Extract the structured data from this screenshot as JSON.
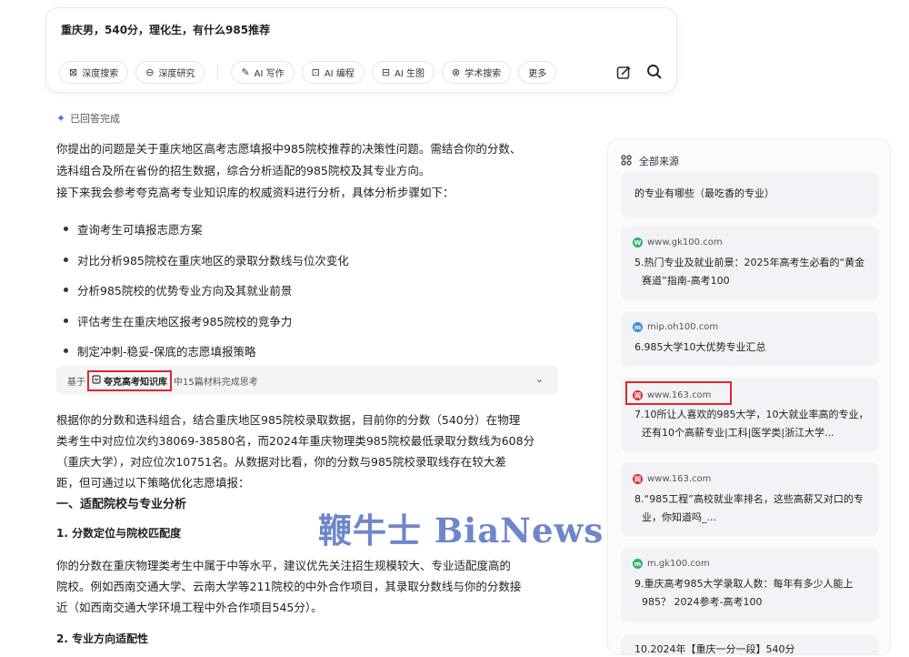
{
  "query": {
    "text": "重庆男，540分，理化生，有什么985推荐",
    "tools": [
      {
        "label": "深度搜索",
        "icon": "deep-search-icon",
        "glyph": "⊠"
      },
      {
        "label": "深度研究",
        "icon": "deep-research-icon",
        "glyph": "⊖"
      },
      {
        "label": "AI 写作",
        "icon": "pen-icon",
        "glyph": "✎"
      },
      {
        "label": "AI 编程",
        "icon": "code-icon",
        "glyph": "⊡"
      },
      {
        "label": "AI 生图",
        "icon": "image-icon",
        "glyph": "⊟"
      },
      {
        "label": "学术搜索",
        "icon": "academic-icon",
        "glyph": "⊗"
      },
      {
        "label": "更多",
        "icon": "",
        "glyph": ""
      }
    ]
  },
  "status": {
    "done_label": "已回答完成"
  },
  "intro": {
    "lines": [
      "你提出的问题是关于重庆地区高考志愿填报中985院校推荐的决策性问题。需结合你的分数、",
      "选科组合及所在省份的招生数据，综合分析适配的985院校及其专业方向。",
      "接下来我会参考夸克高考专业知识库的权威资料进行分析，具体分析步骤如下："
    ]
  },
  "steps": [
    "查询考生可填报志愿方案",
    "对比分析985院校在重庆地区的录取分数线与位次变化",
    "分析985院校的优势专业方向及其就业前景",
    "评估考生在重庆地区报考985院校的竞争力",
    "制定冲刺-稳妥-保底的志愿填报策略"
  ],
  "basis": {
    "prefix": "基于",
    "kb_name": "夸克高考知识库",
    "suffix": "中15篇材料完成思考"
  },
  "analysis": {
    "lines": [
      "根据你的分数和选科组合，结合重庆地区985院校录取数据，目前你的分数（540分）在物理",
      "类考生中对应位次约38069-38580名，而2024年重庆物理类985院校最低录取分数线为608分",
      "（重庆大学），对应位次10751名。从数据对比看，你的分数与985院校录取线存在较大差",
      "距，但可通过以下策略优化志愿填报："
    ]
  },
  "section1": {
    "title": "一、适配院校与专业分析",
    "sub1": "1. 分数定位与院校匹配度",
    "para_lines": [
      "你的分数在重庆物理类考生中属于中等水平，建议优先关注招生规模较大、专业适配度高的",
      "院校。例如西南交通大学、云南大学等211院校的中外合作项目，其录取分数线与你的分数接",
      "近（如西南交通大学环境工程中外合作项目545分）。"
    ],
    "sub2": "2. 专业方向适配性"
  },
  "watermark": "鞭牛士 BiaNews",
  "sources": {
    "header": "全部来源",
    "clipped_title": "的专业有哪些（最吃香的专业）",
    "items": [
      {
        "domain": "www.gk100.com",
        "title": "5.热门专业及就业前景：2025年高考生必看的“黄金赛道”指南-高考100",
        "favicon_color": "#2fb36b",
        "favicon_letter": "W"
      },
      {
        "domain": "mip.oh100.com",
        "title": "6.985大学10大优势专业汇总",
        "favicon_color": "#3b8fd6",
        "favicon_letter": "m"
      },
      {
        "domain": "www.163.com",
        "title": "7.10所让人喜欢的985大学，10大就业率高的专业，还有10个高薪专业|工科|医学类|浙江大学...",
        "favicon_color": "#d9282f",
        "favicon_letter": "网"
      },
      {
        "domain": "www.163.com",
        "title": "8.“985工程”高校就业率排名，这些高薪又对口的专业，你知道吗_...",
        "favicon_color": "#d9282f",
        "favicon_letter": "网"
      },
      {
        "domain": "m.gk100.com",
        "title": "9.重庆高考985大学录取人数：每年有多少人能上985？ 2024参考-高考100",
        "favicon_color": "#2fb36b",
        "favicon_letter": "m"
      }
    ],
    "bottom_clip": "10.2024年【重庆一分一段】540分"
  },
  "colors": {
    "accent": "#4a6cf7",
    "highlight_box": "#e0262b"
  }
}
